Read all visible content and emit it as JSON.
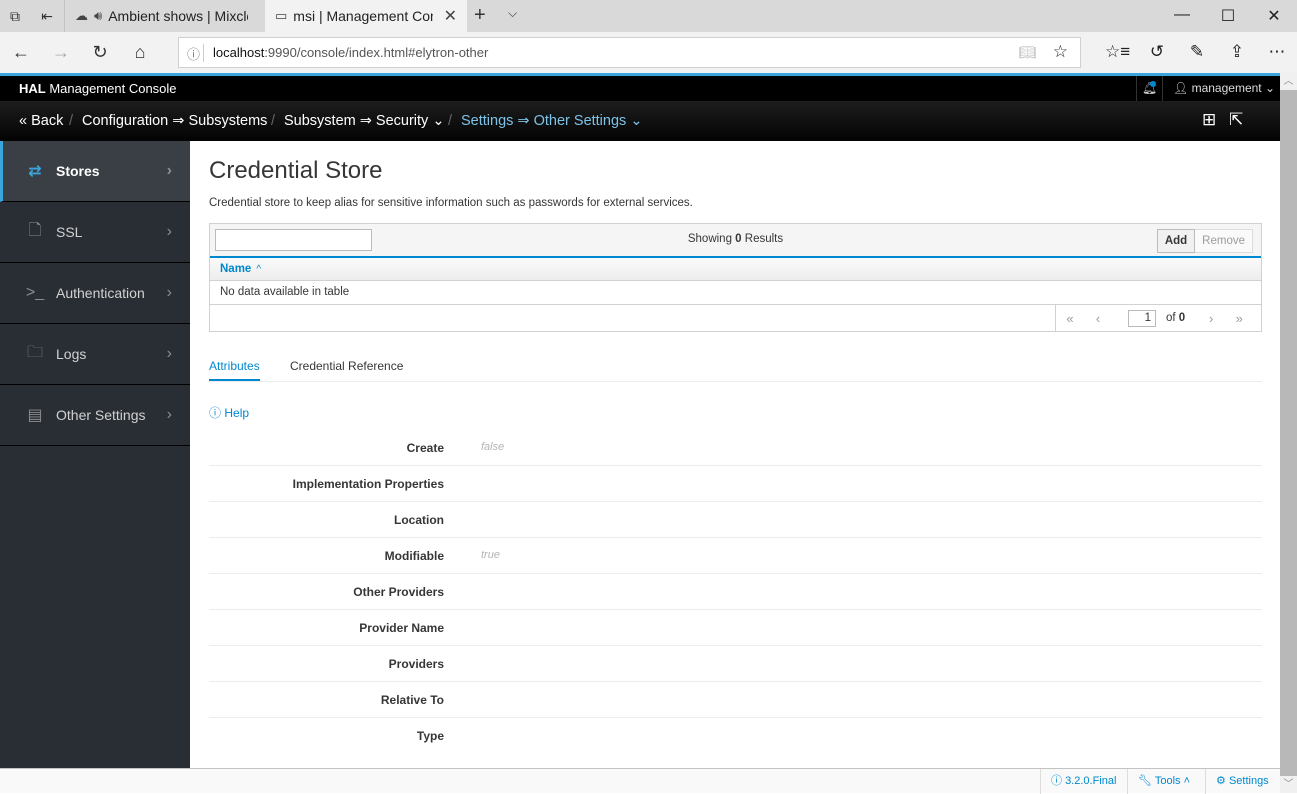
{
  "browser": {
    "tabs": [
      {
        "title": "Ambient shows | Mixclc",
        "icon": "cloud-icon",
        "audio": true,
        "active": false
      },
      {
        "title": "msi | Management Con:",
        "icon": "page-icon",
        "active": true
      }
    ],
    "url_host": "localhost",
    "url_rest": ":9990/console/index.html#elytron-other"
  },
  "hal": {
    "brand_bold": "HAL",
    "brand_rest": " Management Console",
    "user": "management",
    "breadcrumbs": {
      "back": "Back",
      "c1": "Configuration ⇒ Subsystems",
      "c2": "Subsystem ⇒ Security",
      "c3": "Settings ⇒ Other Settings"
    }
  },
  "sidebar": {
    "items": [
      {
        "label": "Stores",
        "icon": "exchange-icon",
        "active": true
      },
      {
        "label": "SSL",
        "icon": "file-icon",
        "active": false
      },
      {
        "label": "Authentication",
        "icon": "terminal-icon",
        "active": false
      },
      {
        "label": "Logs",
        "icon": "folder-icon",
        "active": false
      },
      {
        "label": "Other Settings",
        "icon": "id-card-icon",
        "active": false
      }
    ]
  },
  "main": {
    "title": "Credential Store",
    "description": "Credential store to keep alias for sensitive information such as passwords for external services.",
    "table": {
      "filter_value": "",
      "count_prefix": "Showing ",
      "count": "0",
      "count_suffix": " Results",
      "add_label": "Add",
      "remove_label": "Remove",
      "column": "Name",
      "empty_text": "No data available in table",
      "page": "1",
      "of_label": "of",
      "total_pages": "0"
    },
    "tabs": [
      "Attributes",
      "Credential Reference"
    ],
    "help_label": "Help",
    "attributes": [
      {
        "label": "Create",
        "value": "false"
      },
      {
        "label": "Implementation Properties",
        "value": ""
      },
      {
        "label": "Location",
        "value": ""
      },
      {
        "label": "Modifiable",
        "value": "true"
      },
      {
        "label": "Other Providers",
        "value": ""
      },
      {
        "label": "Provider Name",
        "value": ""
      },
      {
        "label": "Providers",
        "value": ""
      },
      {
        "label": "Relative To",
        "value": ""
      },
      {
        "label": "Type",
        "value": ""
      }
    ]
  },
  "footer": {
    "version": "3.2.0.Final",
    "tools": "Tools",
    "settings": "Settings"
  },
  "colors": {
    "accent": "#39a5dc",
    "link": "#0088ce",
    "sidebar_bg": "#292e34"
  }
}
